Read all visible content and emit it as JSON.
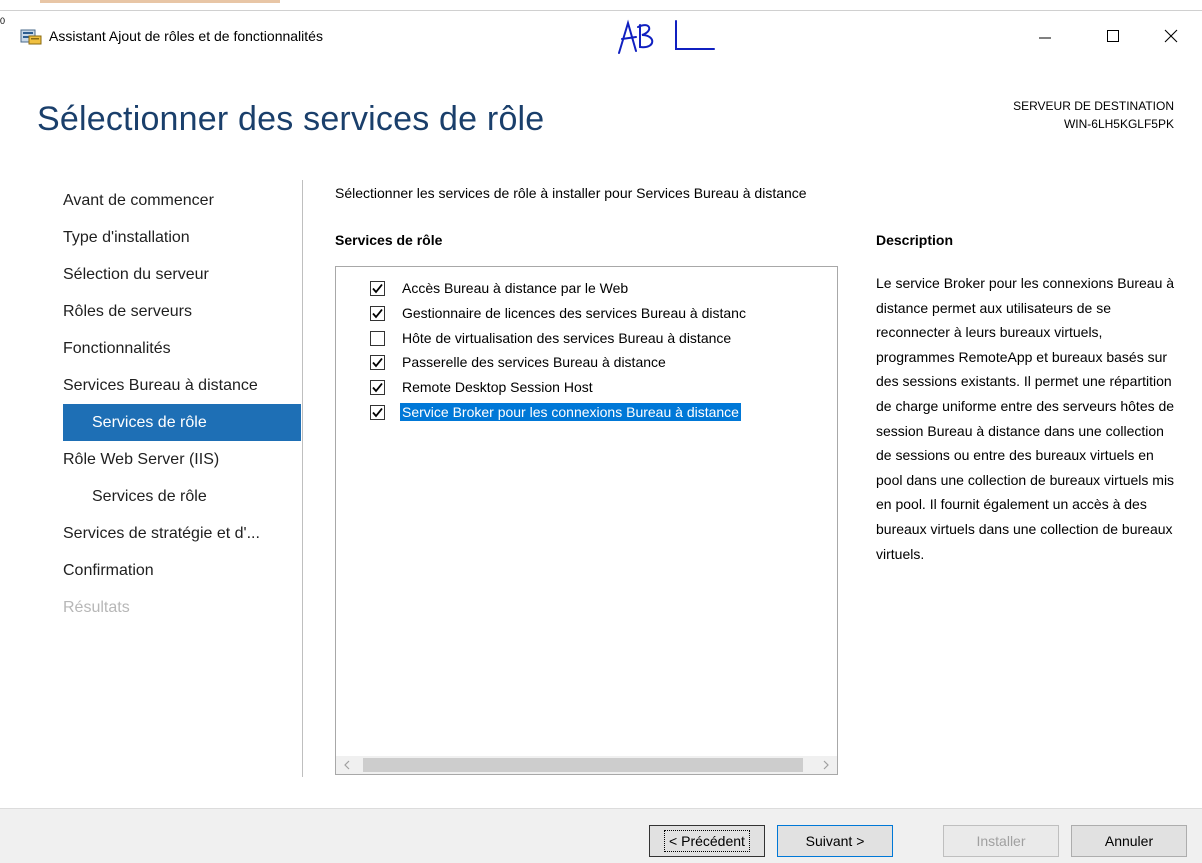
{
  "window": {
    "title": "Assistant Ajout de rôles et de fonctionnalités",
    "corner_mark": "0"
  },
  "header": {
    "page_title": "Sélectionner des services de rôle",
    "destination_label": "SERVEUR DE DESTINATION",
    "destination_server": "WIN-6LH5KGLF5PK"
  },
  "nav": {
    "items": [
      {
        "label": "Avant de commencer"
      },
      {
        "label": "Type d'installation"
      },
      {
        "label": "Sélection du serveur"
      },
      {
        "label": "Rôles de serveurs"
      },
      {
        "label": "Fonctionnalités"
      },
      {
        "label": "Services Bureau à distance"
      },
      {
        "label": "Services de rôle"
      },
      {
        "label": "Rôle Web Server (IIS)"
      },
      {
        "label": "Services de rôle"
      },
      {
        "label": "Services de stratégie et d'..."
      },
      {
        "label": "Confirmation"
      },
      {
        "label": "Résultats"
      }
    ]
  },
  "main": {
    "intro": "Sélectionner les services de rôle à installer pour Services Bureau à distance",
    "roles_heading": "Services de rôle",
    "description_heading": "Description",
    "roles": [
      {
        "label": "Accès Bureau à distance par le Web",
        "checked": true
      },
      {
        "label": "Gestionnaire de licences des services Bureau à distanc",
        "checked": true
      },
      {
        "label": "Hôte de virtualisation des services Bureau à distance",
        "checked": false
      },
      {
        "label": "Passerelle des services Bureau à distance",
        "checked": true
      },
      {
        "label": "Remote Desktop Session Host",
        "checked": true
      },
      {
        "label": "Service Broker pour les connexions Bureau à distance",
        "checked": true
      }
    ],
    "description": "Le service Broker pour les connexions Bureau à distance permet aux utilisateurs de se reconnecter à leurs bureaux virtuels, programmes RemoteApp et bureaux basés sur des sessions existants. Il permet une répartition de charge uniforme entre des serveurs hôtes de session Bureau à distance dans une collection de sessions ou entre des bureaux virtuels en pool dans une collection de bureaux virtuels mis en pool. Il fournit également un accès à des bureaux virtuels dans une collection de bureaux virtuels."
  },
  "footer": {
    "previous": "< Précédent",
    "next": "Suivant >",
    "install": "Installer",
    "cancel": "Annuler"
  },
  "colors": {
    "title_blue": "#1a3f6b",
    "nav_selected": "#1e6fb5",
    "list_selected": "#0078d7",
    "scribble": "#1020c0"
  },
  "icons": {
    "app": "server-manager-icon",
    "minimize": "minimize-icon",
    "maximize": "maximize-icon",
    "close": "close-icon"
  }
}
